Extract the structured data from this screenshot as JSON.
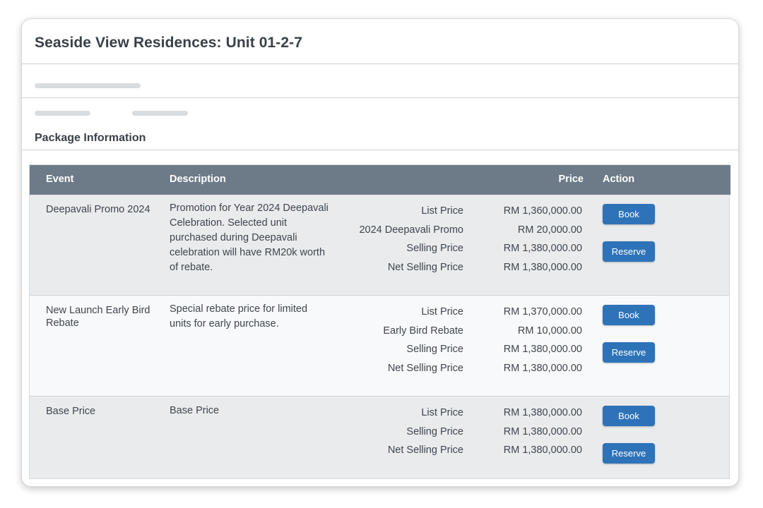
{
  "header": {
    "title": "Seaside View Residences: Unit 01-2-7"
  },
  "section": {
    "title": "Package Information"
  },
  "table": {
    "columns": {
      "event": "Event",
      "description": "Description",
      "price": "Price",
      "action": "Action"
    },
    "rows": [
      {
        "event": "Deepavali Promo 2024",
        "description": "Promotion for Year 2024 Deepavali Celebration. Selected unit purchased during Deepavali celebration will have RM20k worth of rebate.",
        "prices": [
          {
            "label": "List Price",
            "value": "RM 1,360,000.00"
          },
          {
            "label": "2024 Deepavali Promo",
            "value": "RM 20,000.00"
          },
          {
            "label": "Selling Price",
            "value": "RM 1,380,000.00"
          },
          {
            "label": "Net Selling Price",
            "value": "RM 1,380,000.00"
          }
        ],
        "book_label": "Book",
        "reserve_label": "Reserve"
      },
      {
        "event": "New Launch Early Bird Rebate",
        "description": "Special rebate price for limited units for early purchase.",
        "prices": [
          {
            "label": "List Price",
            "value": "RM 1,370,000.00"
          },
          {
            "label": "Early Bird Rebate",
            "value": "RM 10,000.00"
          },
          {
            "label": "Selling Price",
            "value": "RM 1,380,000.00"
          },
          {
            "label": "Net Selling Price",
            "value": "RM 1,380,000.00"
          }
        ],
        "book_label": "Book",
        "reserve_label": "Reserve"
      },
      {
        "event": "Base Price",
        "description": "Base Price",
        "prices": [
          {
            "label": "List Price",
            "value": "RM 1,380,000.00"
          },
          {
            "label": "Selling Price",
            "value": "RM 1,380,000.00"
          },
          {
            "label": "Net Selling Price",
            "value": "RM 1,380,000.00"
          }
        ],
        "book_label": "Book",
        "reserve_label": "Reserve"
      }
    ]
  },
  "colors": {
    "header_bg": "#6d7b88",
    "button_bg": "#2e73b8",
    "row_shade": "#e9ebed",
    "row_plain": "#f8f9fa"
  }
}
